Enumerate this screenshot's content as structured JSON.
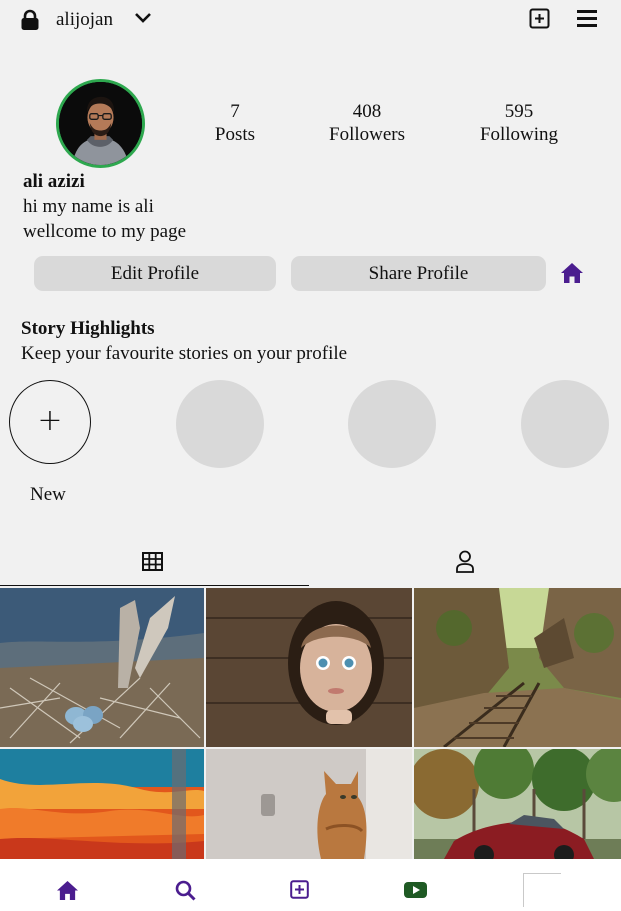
{
  "header": {
    "username": "alijojan",
    "icons": [
      "lock-icon",
      "chevron-down-icon",
      "add-square-icon",
      "menu-icon"
    ]
  },
  "profile": {
    "stats": [
      {
        "value": "7",
        "label": "Posts"
      },
      {
        "value": "408",
        "label": "Followers"
      },
      {
        "value": "595",
        "label": "Following"
      }
    ],
    "name": "ali azizi",
    "bio_line1": "hi my name is ali",
    "bio_line2": "wellcome to my page"
  },
  "actions": {
    "edit_label": "Edit Profile",
    "share_label": "Share Profile"
  },
  "highlights": {
    "title": "Story Highlights",
    "subtitle": "Keep your favourite stories on your profile",
    "new_symbol": "+",
    "new_label": "New"
  },
  "tabs": [
    "grid-icon",
    "tagged-user-icon"
  ],
  "posts": [
    "eggs-in-nest-photo",
    "child-peeking-through-wood-photo",
    "abandoned-railway-canyon-photo",
    "orange-blue-abstract-photo",
    "ginger-cat-at-window-photo",
    "red-car-in-forest-photo"
  ],
  "bottom_nav": [
    "home-icon",
    "search-icon",
    "add-square-icon",
    "video-icon",
    "profile-picture"
  ],
  "colors": {
    "accent_purple": "#4b1d8f",
    "avatar_ring": "#2ea84f",
    "button_bg": "#d9d9d9",
    "page_bg": "#f1f1f1",
    "reels_green": "#1f5a24"
  }
}
